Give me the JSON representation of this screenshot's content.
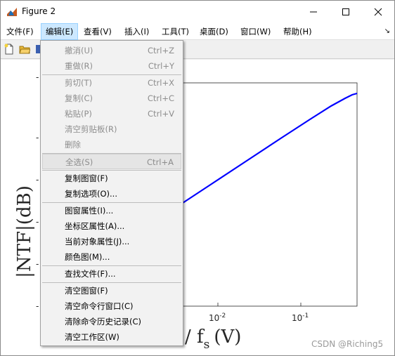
{
  "window": {
    "title": "Figure 2",
    "controls": [
      "minimize",
      "maximize",
      "close"
    ]
  },
  "menubar": {
    "items": [
      {
        "label": "文件(F)",
        "active": false
      },
      {
        "label": "编辑(E)",
        "active": true
      },
      {
        "label": "查看(V)",
        "active": false
      },
      {
        "label": "插入(I)",
        "active": false
      },
      {
        "label": "工具(T)",
        "active": false
      },
      {
        "label": "桌面(D)",
        "active": false
      },
      {
        "label": "窗口(W)",
        "active": false
      },
      {
        "label": "帮助(H)",
        "active": false
      }
    ],
    "overflow_arrow": "↘"
  },
  "toolbar": {
    "icons": [
      "new-file-icon",
      "open-folder-icon",
      "save-icon"
    ]
  },
  "edit_menu": {
    "groups": [
      [
        {
          "label": "撤消(U)",
          "shortcut": "Ctrl+Z",
          "enabled": false
        },
        {
          "label": "重做(R)",
          "shortcut": "Ctrl+Y",
          "enabled": false
        }
      ],
      [
        {
          "label": "剪切(T)",
          "shortcut": "Ctrl+X",
          "enabled": false
        },
        {
          "label": "复制(C)",
          "shortcut": "Ctrl+C",
          "enabled": false
        },
        {
          "label": "粘贴(P)",
          "shortcut": "Ctrl+V",
          "enabled": false
        },
        {
          "label": "清空剪贴板(R)",
          "shortcut": "",
          "enabled": false
        },
        {
          "label": "删除",
          "shortcut": "",
          "enabled": false
        }
      ],
      [
        {
          "label": "全选(S)",
          "shortcut": "Ctrl+A",
          "enabled": false,
          "highlighted": true
        }
      ],
      [
        {
          "label": "复制图窗(F)",
          "shortcut": "",
          "enabled": true
        },
        {
          "label": "复制选项(O)...",
          "shortcut": "",
          "enabled": true
        }
      ],
      [
        {
          "label": "图窗属性(I)...",
          "shortcut": "",
          "enabled": true
        },
        {
          "label": "坐标区属性(A)...",
          "shortcut": "",
          "enabled": true
        },
        {
          "label": "当前对象属性(J)...",
          "shortcut": "",
          "enabled": true
        },
        {
          "label": "颜色图(M)...",
          "shortcut": "",
          "enabled": true
        }
      ],
      [
        {
          "label": "查找文件(F)...",
          "shortcut": "",
          "enabled": true
        }
      ],
      [
        {
          "label": "清空图窗(F)",
          "shortcut": "",
          "enabled": true
        },
        {
          "label": "清空命令行窗口(C)",
          "shortcut": "",
          "enabled": true
        },
        {
          "label": "清除命令历史记录(C)",
          "shortcut": "",
          "enabled": true
        },
        {
          "label": "清空工作区(W)",
          "shortcut": "",
          "enabled": true
        }
      ]
    ]
  },
  "plot": {
    "ylabel": "|NTF|(dB)",
    "xlabel_main": "/ f",
    "xlabel_sub": "s",
    "xlabel_unit": "(V)",
    "xticks": [
      {
        "base": "10",
        "exp": "-2"
      },
      {
        "base": "10",
        "exp": "-1"
      }
    ],
    "ytick_glyph": "-",
    "line_color": "#0000ff"
  },
  "watermark": "CSDN @Riching5"
}
